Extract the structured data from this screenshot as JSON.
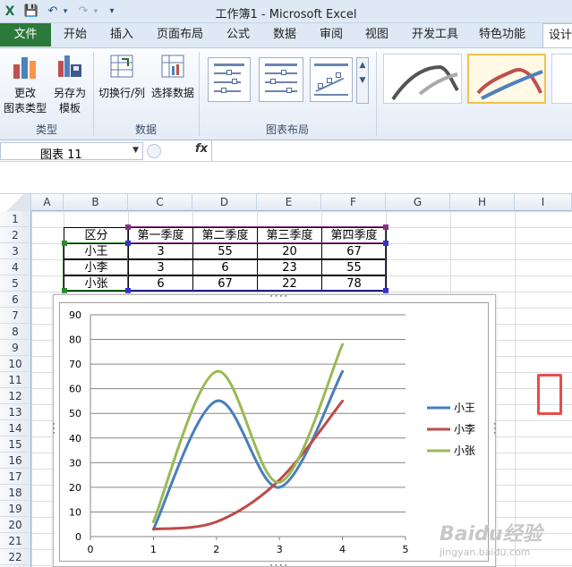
{
  "window": {
    "title": "工作簿1 - Microsoft Excel"
  },
  "qat": {
    "save": "💾",
    "undo": "↶",
    "redo": "↷",
    "more": "▾"
  },
  "tabs": [
    "开始",
    "插入",
    "页面布局",
    "公式",
    "数据",
    "审阅",
    "视图",
    "开发工具",
    "特色功能",
    "设计"
  ],
  "file_tab": "文件",
  "ribbon": {
    "groups": [
      {
        "label": "类型",
        "buttons": [
          "更改\n图表类型",
          "另存为\n模板"
        ]
      },
      {
        "label": "数据",
        "buttons": [
          "切换行/列",
          "选择数据"
        ]
      },
      {
        "label": "图表布局"
      }
    ],
    "btn_change_type_1": "更改",
    "btn_change_type_2": "图表类型",
    "btn_save_template_1": "另存为",
    "btn_save_template_2": "模板",
    "btn_switch_row_col": "切换行/列",
    "btn_select_data": "选择数据",
    "group_type": "类型",
    "group_data": "数据",
    "group_layout": "图表布局"
  },
  "formula_bar": {
    "name_box": "图表 11",
    "fx": "fx",
    "value": ""
  },
  "columns": [
    "A",
    "B",
    "C",
    "D",
    "E",
    "F",
    "G",
    "H",
    "I"
  ],
  "rows": [
    "1",
    "2",
    "3",
    "4",
    "5",
    "6",
    "7",
    "8",
    "9",
    "10",
    "11",
    "12",
    "13",
    "14",
    "15",
    "16",
    "17",
    "18",
    "19",
    "20",
    "21",
    "22"
  ],
  "table": {
    "headers": [
      "区分",
      "第一季度",
      "第二季度",
      "第三季度",
      "第四季度"
    ],
    "rows": [
      [
        "小王",
        "3",
        "55",
        "20",
        "67"
      ],
      [
        "小李",
        "3",
        "6",
        "23",
        "55"
      ],
      [
        "小张",
        "6",
        "67",
        "22",
        "78"
      ]
    ]
  },
  "chart_data": {
    "type": "scatter",
    "title": "",
    "xlabel": "",
    "ylabel": "",
    "xlim": [
      0,
      5
    ],
    "ylim": [
      0,
      90
    ],
    "x_ticks": [
      0,
      1,
      2,
      3,
      4,
      5
    ],
    "y_ticks": [
      0,
      10,
      20,
      30,
      40,
      50,
      60,
      70,
      80,
      90
    ],
    "grid": true,
    "smooth": true,
    "legend_position": "right",
    "series": [
      {
        "name": "小王",
        "color": "#4a7ebb",
        "x": [
          1,
          2,
          3,
          4
        ],
        "y": [
          3,
          55,
          20,
          67
        ]
      },
      {
        "name": "小李",
        "color": "#be4b48",
        "x": [
          1,
          2,
          3,
          4
        ],
        "y": [
          3,
          6,
          23,
          55
        ]
      },
      {
        "name": "小张",
        "color": "#98b954",
        "x": [
          1,
          2,
          3,
          4
        ],
        "y": [
          6,
          67,
          22,
          78
        ]
      }
    ]
  },
  "watermark": {
    "text": "Baidu经验",
    "sub": "jingyan.baidu.com"
  },
  "colors": {
    "file_tab": "#2c7a3b",
    "accent_red": "#e84c4c"
  }
}
